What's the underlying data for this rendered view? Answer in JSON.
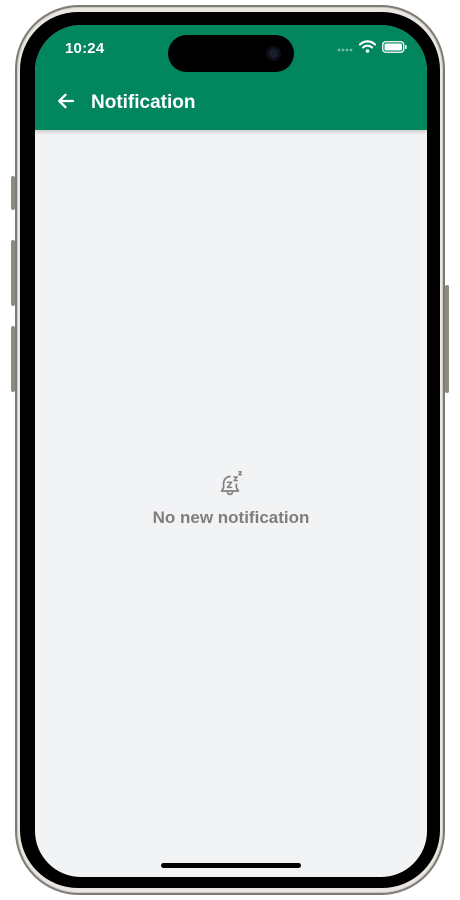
{
  "status_bar": {
    "time": "10:24",
    "icons": [
      "cellular-signal-icon",
      "wifi-icon",
      "battery-icon"
    ]
  },
  "app_bar": {
    "back_icon": "arrow-left-icon",
    "title": "Notification"
  },
  "empty_state": {
    "icon": "bell-snooze-icon",
    "message": "No new notification"
  },
  "colors": {
    "header": "#02865e",
    "screen_background": "#f2f3f5",
    "empty_text": "#7e7e7e"
  }
}
